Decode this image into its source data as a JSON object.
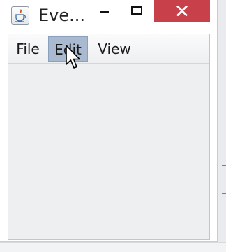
{
  "window": {
    "title": "Eve...",
    "minimize_label": "Minimize",
    "maximize_label": "Maximize",
    "close_label": "Close"
  },
  "menubar": {
    "items": [
      {
        "label": "File"
      },
      {
        "label": "Edit",
        "highlighted": true
      },
      {
        "label": "View"
      }
    ]
  },
  "icons": {
    "app": "java-coffee-cup-icon",
    "cursor": "mouse-pointer-icon"
  },
  "colors": {
    "close_button": "#c7404a",
    "menu_highlight": "#a9b9cf",
    "client_background": "#eeeff1"
  }
}
